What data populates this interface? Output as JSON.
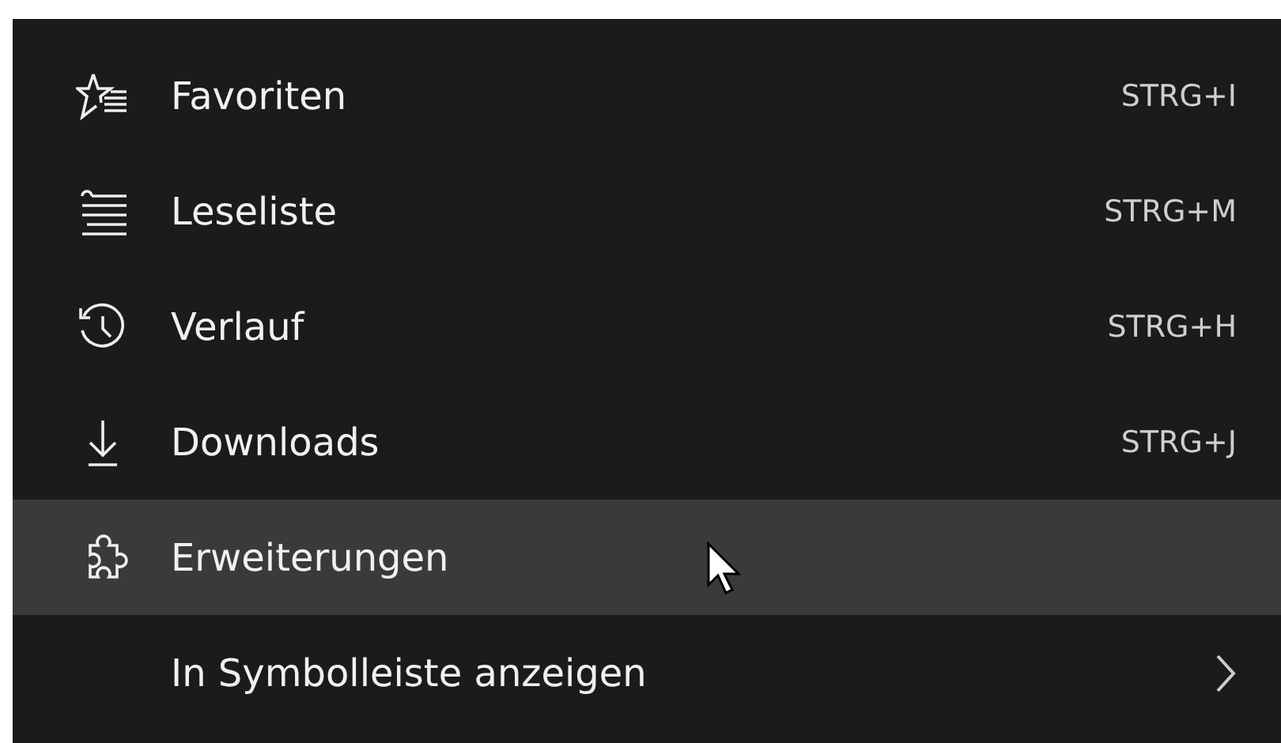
{
  "menu": {
    "items": [
      {
        "label": "Favoriten",
        "shortcut": "STRG+I",
        "selected": false,
        "submenu": false
      },
      {
        "label": "Leseliste",
        "shortcut": "STRG+M",
        "selected": false,
        "submenu": false
      },
      {
        "label": "Verlauf",
        "shortcut": "STRG+H",
        "selected": false,
        "submenu": false
      },
      {
        "label": "Downloads",
        "shortcut": "STRG+J",
        "selected": false,
        "submenu": false
      },
      {
        "label": "Erweiterungen",
        "selected": true,
        "submenu": false
      },
      {
        "label": "In Symbolleiste anzeigen",
        "selected": false,
        "submenu": true
      }
    ]
  }
}
